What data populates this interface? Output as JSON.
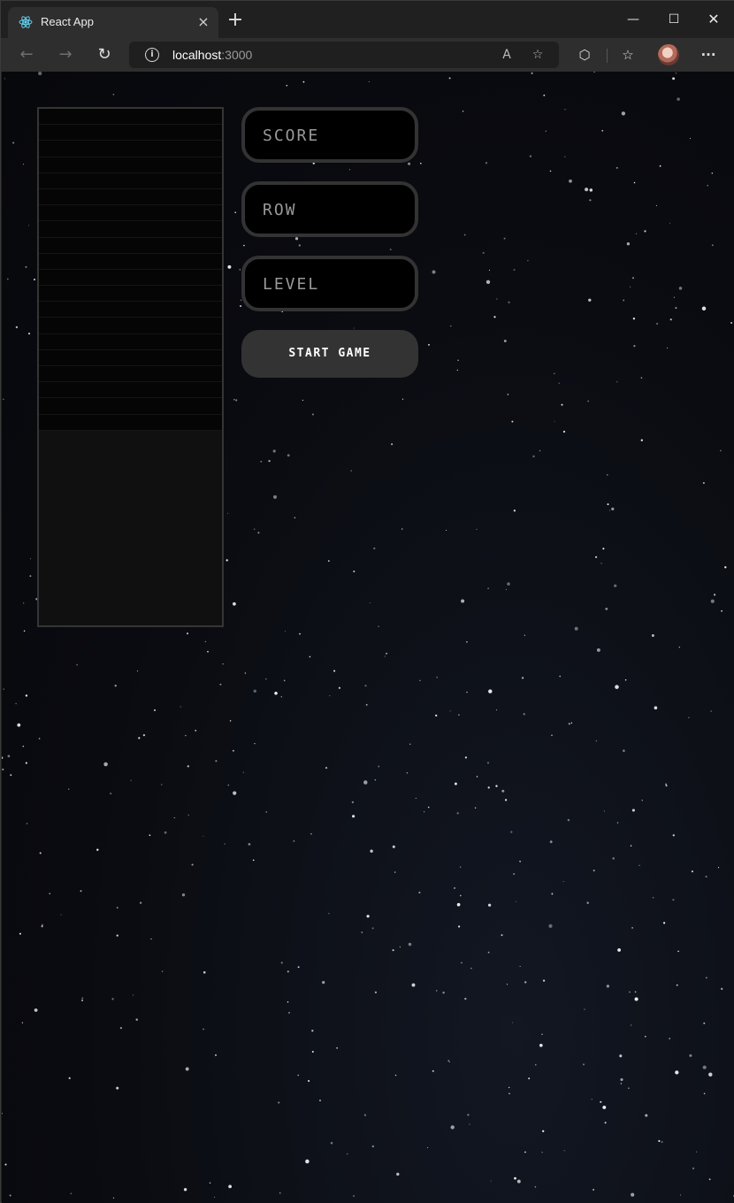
{
  "browser": {
    "tab": {
      "title": "React App",
      "favicon": "react-logo-icon",
      "close_label": "×"
    },
    "new_tab_label": "+",
    "window_controls": {
      "minimize": "—",
      "maximize": "☐",
      "close": "✕"
    },
    "nav": {
      "back": "←",
      "forward": "→",
      "reload": "↻"
    },
    "address": {
      "host": "localhost",
      "port": ":3000"
    },
    "icons": {
      "read_aloud": "A",
      "add_favorite": "☆",
      "extensions": "⬡",
      "favorites": "☆",
      "more": "···"
    }
  },
  "game": {
    "displays": [
      {
        "label": "SCORE"
      },
      {
        "label": "ROW"
      },
      {
        "label": "LEVEL"
      }
    ],
    "start_button": "START GAME"
  },
  "colors": {
    "board_border": "#353535",
    "display_border": "#333333",
    "display_text": "#999999",
    "button_bg": "#333333",
    "button_text": "#ffffff"
  }
}
